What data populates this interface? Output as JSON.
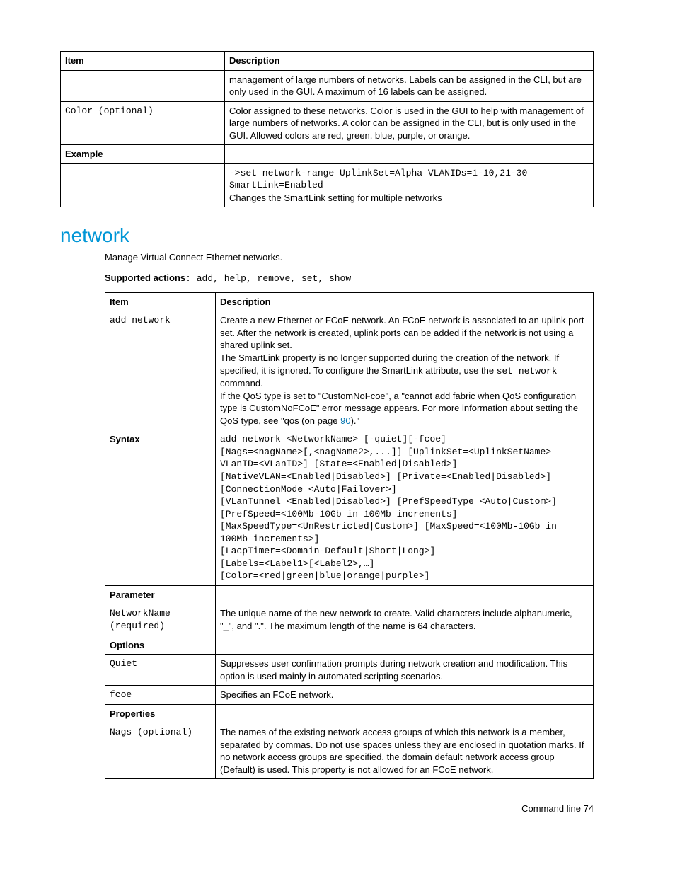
{
  "table1": {
    "headers": [
      "Item",
      "Description"
    ],
    "rows": [
      {
        "item": "",
        "desc": "management of large numbers of networks. Labels can be assigned in the CLI, but are only used in the GUI. A maximum of 16 labels can be assigned."
      },
      {
        "item": "Color (optional)",
        "item_mono": true,
        "desc": "Color assigned to these networks. Color is used in the GUI to help with management of large numbers of networks. A color can be assigned in the CLI, but is only used in the GUI. Allowed colors are red, green, blue, purple, or orange."
      }
    ],
    "example_header": "Example",
    "example_code": "->set network-range UplinkSet=Alpha VLANIDs=1-10,21-30 SmartLink=Enabled",
    "example_text": "Changes the SmartLink setting for multiple networks"
  },
  "heading": "network",
  "intro": "Manage Virtual Connect Ethernet networks.",
  "supported_label": "Supported actions",
  "supported_value": ": add, help, remove, set, show",
  "table2": {
    "headers": [
      "Item",
      "Description"
    ],
    "add_item": "add network",
    "add_desc_p1": "Create a new Ethernet or FCoE network. An FCoE network is associated to an uplink port set. After the network is created, uplink ports can be added if the network is not using a shared uplink set.",
    "add_desc_p2a": "The SmartLink property is no longer supported during the creation of the network. If specified, it is ignored. To configure the SmartLink attribute, use the ",
    "add_desc_p2_code": "set network",
    "add_desc_p2b": " command.",
    "add_desc_p3a": "If the QoS type is set to \"CustomNoFcoe\", a \"cannot add fabric when QoS configuration type is CustomNoFCoE\" error message appears. For more information about setting the QoS type, see \"qos (on page ",
    "add_desc_p3_link": "90",
    "add_desc_p3b": ").\"",
    "syntax_label": "Syntax",
    "syntax_code": "add network <NetworkName> [-quiet][-fcoe]\n[Nags=<nagName>[,<nagName2>,...]] [UplinkSet=<UplinkSetName>\nVLanID=<VLanID>] [State=<Enabled|Disabled>]\n[NativeVLAN=<Enabled|Disabled>] [Private=<Enabled|Disabled>]\n[ConnectionMode=<Auto|Failover>]\n[VLanTunnel=<Enabled|Disabled>] [PrefSpeedType=<Auto|Custom>]\n[PrefSpeed=<100Mb-10Gb in 100Mb increments]\n[MaxSpeedType=<UnRestricted|Custom>] [MaxSpeed=<100Mb-10Gb in\n100Mb increments>]\n[LacpTimer=<Domain-Default|Short|Long>]\n[Labels=<Label1>[<Label2>,…]\n[Color=<red|green|blue|orange|purple>]",
    "parameter_header": "Parameter",
    "param_item": "NetworkName (required)",
    "param_desc": "The unique name of the new network to create. Valid characters include alphanumeric, \"_\", and \".\". The maximum length of the name is 64 characters.",
    "options_header": "Options",
    "opt1_item": "Quiet",
    "opt1_desc": "Suppresses user confirmation prompts during network creation and modification. This option is used mainly in automated scripting scenarios.",
    "opt2_item": "fcoe",
    "opt2_desc": "Specifies an FCoE network.",
    "properties_header": "Properties",
    "prop_item": "Nags (optional)",
    "prop_desc": "The names of the existing network access groups of which this network is a member, separated by commas. Do not use spaces unless they are enclosed in quotation marks. If no network access groups are specified, the domain default network access group (Default) is used. This property is not allowed for an FCoE network."
  },
  "footer": "Command line  74"
}
